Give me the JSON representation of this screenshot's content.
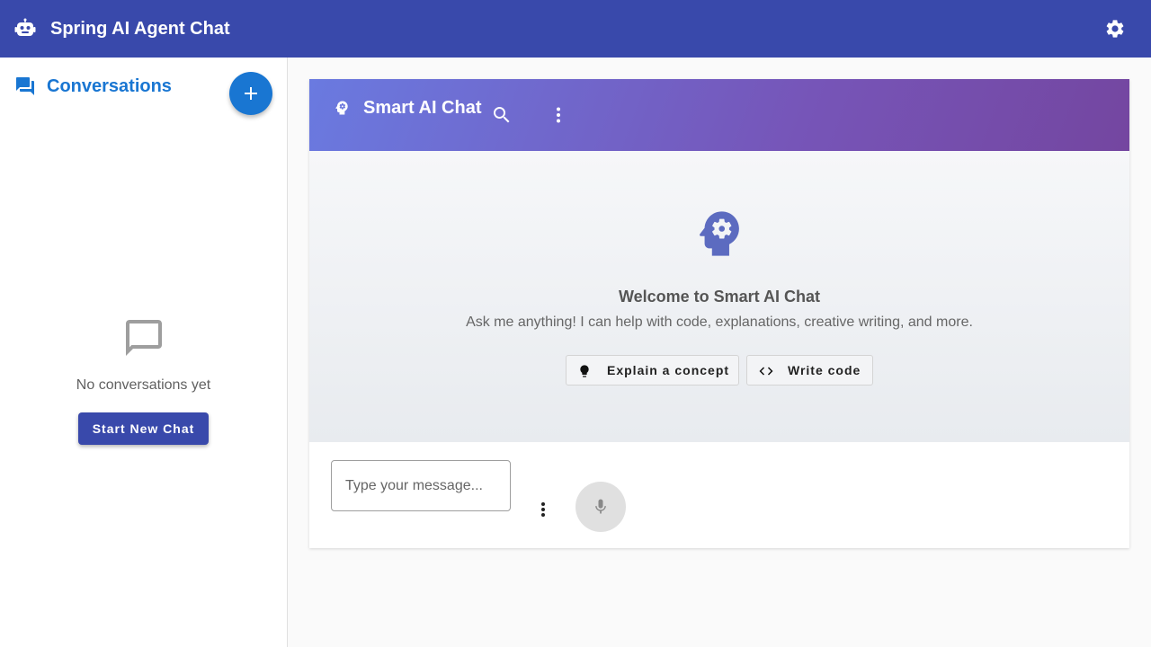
{
  "app": {
    "title": "Spring AI Agent Chat",
    "icon": "robot-icon",
    "settings_icon": "gear-icon",
    "accent_color": "#3949ab"
  },
  "sidebar": {
    "title": "Conversations",
    "title_icon": "forum-icon",
    "new_button_icon": "plus-icon",
    "empty_state": {
      "icon": "chat-bubble-outline-icon",
      "text": "No conversations yet",
      "button_label": "Start New Chat"
    }
  },
  "chat": {
    "title": "Smart AI Chat",
    "header_icon": "psychology-icon",
    "search_icon": "search-icon",
    "menu_icon": "more-vert-icon",
    "welcome": {
      "icon": "psychology-icon",
      "title": "Welcome to Smart AI Chat",
      "subtitle": "Ask me anything! I can help with code, explanations, creative writing, and more."
    },
    "suggestions": [
      {
        "label": "Explain a concept",
        "icon": "lightbulb-icon"
      },
      {
        "label": "Write code",
        "icon": "code-icon"
      }
    ],
    "input": {
      "placeholder": "Type your message...",
      "value": "",
      "menu_icon": "more-vert-icon",
      "mic_icon": "mic-icon"
    }
  }
}
